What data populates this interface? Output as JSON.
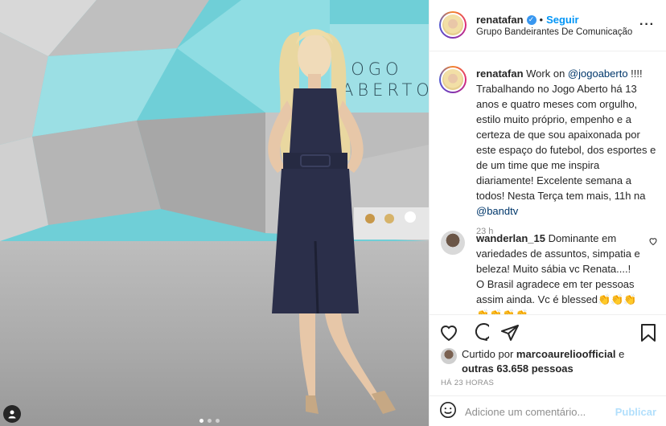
{
  "photo": {
    "logo_line1": "JOGO",
    "logo_line2": "ABERTO",
    "carousel_dots": 3,
    "active_dot": 1
  },
  "header": {
    "username": "renatafan",
    "separator": "•",
    "follow_label": "Seguir",
    "location": "Grupo Bandeirantes De Comunicação",
    "more_icon": "more-icon"
  },
  "caption": {
    "username": "renatafan",
    "text_pre": " Work on ",
    "mention1": "@jogoaberto",
    "text_mid": " !!!! Trabalhando no Jogo Aberto há 13 anos e quatro meses com orgulho, estilo muito próprio, empenho e a certeza de que sou apaixonada por este espaço do futebol, dos esportes e de um time que me inspira diariamente! Excelente semana a todos! Nesta Terça tem mais, 11h na ",
    "mention2": "@bandtv",
    "time": "23 h"
  },
  "comment": {
    "username": "wanderlan_15",
    "text": " Dominante em variedades de assuntos, simpatia e beleza! Muito sábia vc Renata....! O Brasil agradece em ter pessoas assim ainda. Vc é blessed",
    "emojis": "👏👏👏👏👏👏👏"
  },
  "actions": {
    "liked_by_prefix": "Curtido por ",
    "liked_by_user": "marcoaurelioofficial",
    "liked_by_and": " e",
    "others": "outras 63.658 pessoas",
    "time_caps": "HÁ 23 HORAS"
  },
  "add_comment": {
    "placeholder": "Adicione um comentário...",
    "publish_label": "Publicar"
  },
  "colors": {
    "accent": "#0095f6",
    "verified": "#3897f0",
    "wall_cyan": "#7fd6dc",
    "dress": "#2b2f4a"
  }
}
